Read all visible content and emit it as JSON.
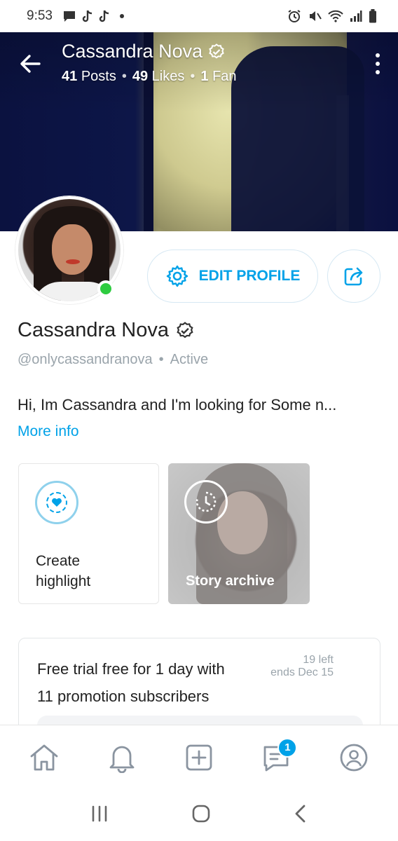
{
  "status_bar": {
    "time": "9:53",
    "left_icons": [
      "chat-icon",
      "tiktok-icon",
      "tiktok-icon",
      "dot"
    ],
    "right_icons": [
      "alarm-icon",
      "mute-icon",
      "wifi-icon",
      "signal-icon",
      "battery-icon"
    ]
  },
  "cover": {
    "title": "Cassandra Nova",
    "stats": {
      "posts_count": "41",
      "posts_label": "Posts",
      "likes_count": "49",
      "likes_label": "Likes",
      "fans_count": "1",
      "fans_label": "Fan",
      "separator": "•"
    }
  },
  "profile": {
    "name": "Cassandra Nova",
    "handle": "@onlycassandranova",
    "separator": "•",
    "status": "Active",
    "bio": "Hi, Im Cassandra and I'm looking for Some n...",
    "more_info": "More info",
    "online_color": "#2ecc40"
  },
  "actions": {
    "edit_profile_label": "EDIT PROFILE"
  },
  "highlights": {
    "create_label_line1": "Create",
    "create_label_line2": "highlight",
    "archive_label": "Story archive"
  },
  "promo": {
    "title_line1": "Free trial free for 1 day with",
    "title_line2": "11 promotion subscribers",
    "left_text": "19 left",
    "ends_text": "ends Dec 15"
  },
  "bottom_nav": {
    "messages_badge": "1",
    "items": [
      "home-icon",
      "bell-icon",
      "add-post-icon",
      "messages-icon",
      "profile-icon"
    ]
  },
  "colors": {
    "accent": "#00a2e8",
    "muted_text": "#9aa4ab"
  }
}
